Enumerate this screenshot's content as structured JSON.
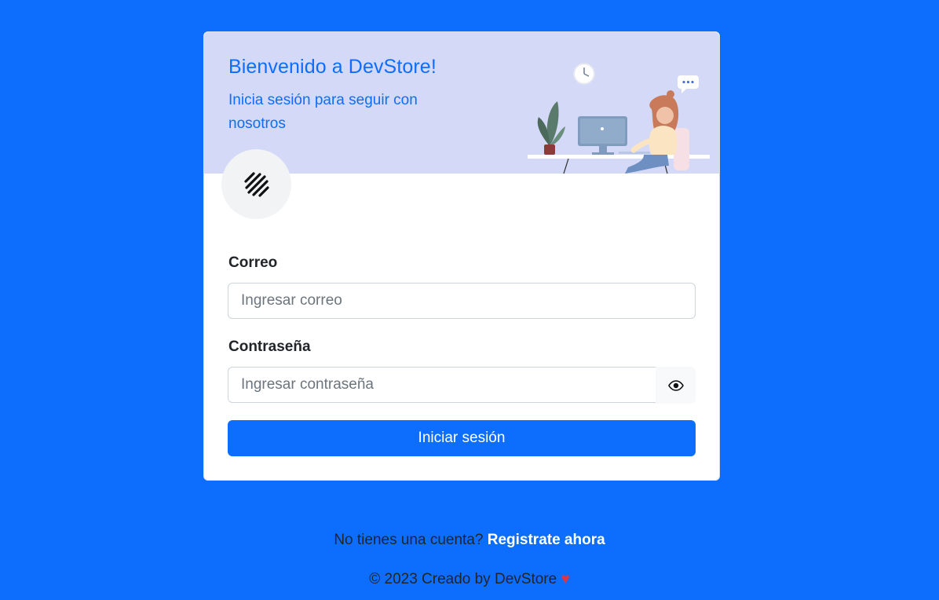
{
  "banner": {
    "title": "Bienvenido a DevStore!",
    "subtitle": "Inicia sesión para seguir con nosotros",
    "illustration": "woman-at-computer-illustration"
  },
  "logo": {
    "icon": "stripes-logo-icon"
  },
  "form": {
    "email_label": "Correo",
    "email_placeholder": "Ingresar correo",
    "email_value": "",
    "password_label": "Contraseña",
    "password_placeholder": "Ingresar contraseña",
    "password_value": "",
    "toggle_icon": "eye-icon",
    "submit_label": "Iniciar sesión"
  },
  "footer": {
    "register_prompt": "No tienes una cuenta?",
    "register_link": "Registrate ahora",
    "copyright": "© 2023 Creado by DevStore",
    "heart": "♥"
  },
  "colors": {
    "page_bg": "#0d6efd",
    "banner_bg": "#d3d9f6",
    "primary": "#0d6efd",
    "heart": "#dc3545"
  }
}
